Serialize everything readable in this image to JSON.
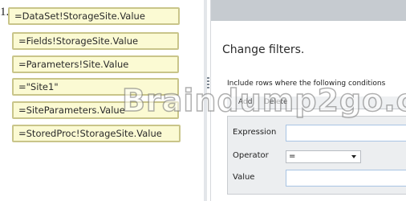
{
  "question_number": "1.)",
  "options": [
    "=DataSet!StorageSite.Value",
    "=Fields!StorageSite.Value",
    "=Parameters!Site.Value",
    "=\"Site1\"",
    "=SiteParameters.Value",
    "=StoredProc!StorageSite.Value"
  ],
  "dialog": {
    "title": "Change filters.",
    "instruction": "Include rows where the following conditions",
    "tabs": [
      "Add",
      "Delete"
    ],
    "fields": {
      "expression_label": "Expression",
      "expression_value": "",
      "operator_label": "Operator",
      "operator_value": "=",
      "value_label": "Value",
      "value_value": ""
    }
  },
  "watermark": "Braindump2go.c",
  "colors": {
    "tile_bg": "#fbfad3",
    "tile_border": "#c9c58a",
    "header_bar": "#c6cbd0",
    "panel_bg": "#eceef0",
    "input_border": "#a9c4e4"
  }
}
